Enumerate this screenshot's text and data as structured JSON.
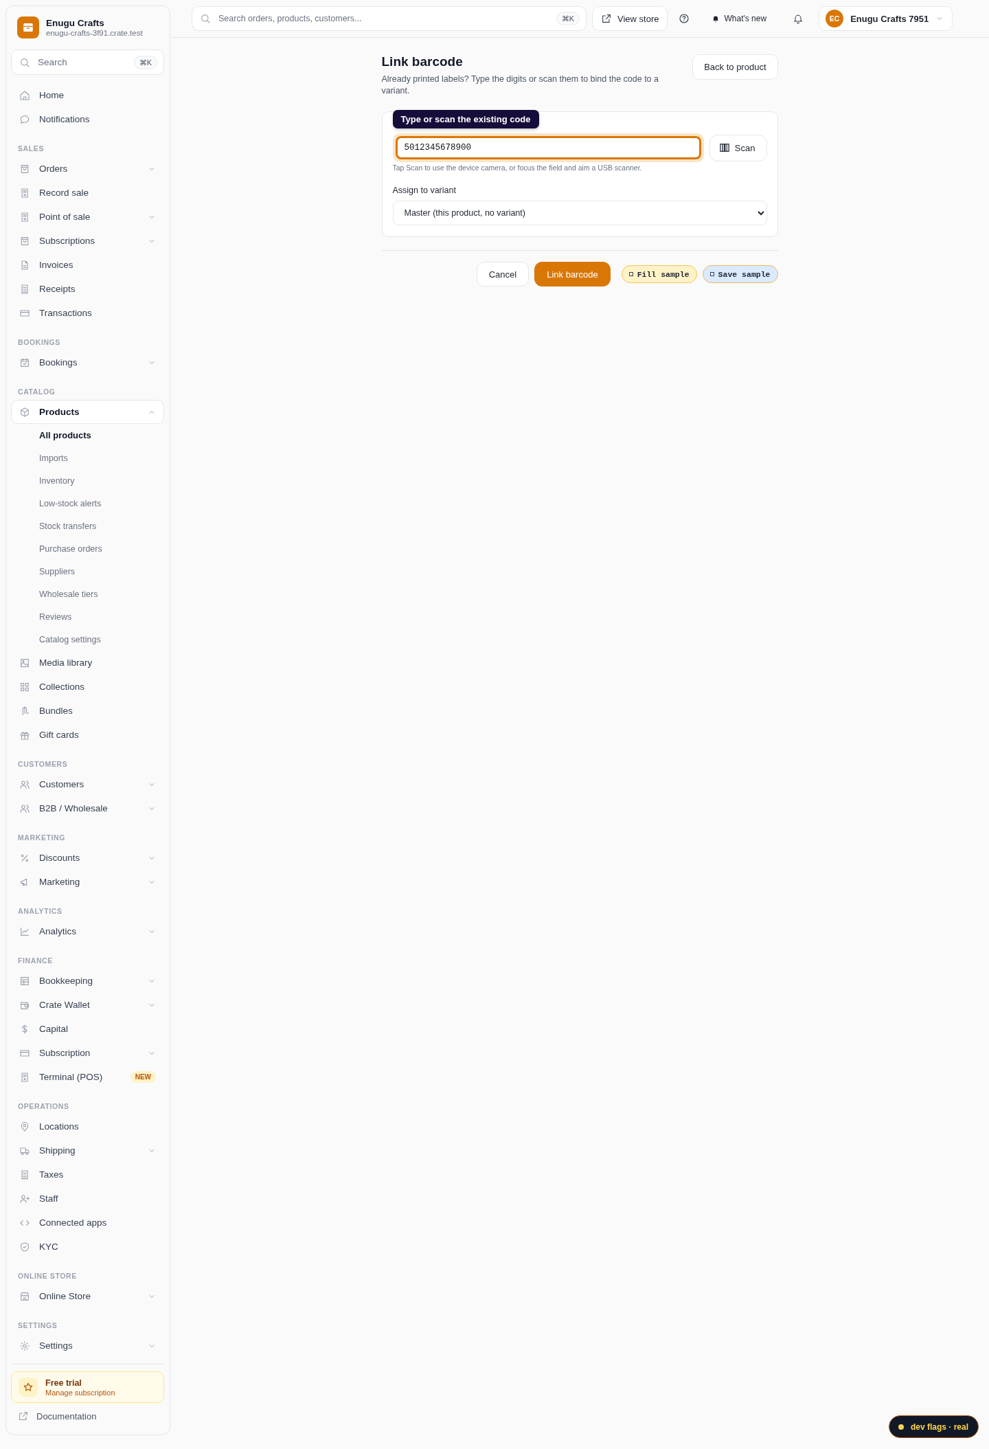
{
  "sidebar": {
    "brand": {
      "name": "Enugu Crafts",
      "domain": "enugu-crafts-3f91.crate.test"
    },
    "search": {
      "placeholder": "Search",
      "shortcut": "⌘K"
    },
    "sections": [
      {
        "items": [
          {
            "label": "Home",
            "kind": "link",
            "selected": false
          },
          {
            "label": "Notifications",
            "kind": "link",
            "selected": false
          }
        ]
      },
      {
        "label": "SALES",
        "items": [
          {
            "label": "Orders",
            "kind": "menu",
            "expanded": false,
            "selected": false
          },
          {
            "label": "Record sale",
            "kind": "link",
            "selected": false
          },
          {
            "label": "Point of sale",
            "kind": "menu",
            "expanded": false,
            "selected": false
          },
          {
            "label": "Subscriptions",
            "kind": "menu",
            "expanded": false,
            "selected": false
          },
          {
            "label": "Invoices",
            "kind": "link",
            "selected": false
          },
          {
            "label": "Receipts",
            "kind": "link",
            "selected": false
          },
          {
            "label": "Transactions",
            "kind": "link",
            "selected": false
          }
        ]
      },
      {
        "label": "BOOKINGS",
        "items": [
          {
            "label": "Bookings",
            "kind": "menu",
            "expanded": false,
            "selected": false
          }
        ]
      },
      {
        "label": "CATALOG",
        "items": [
          {
            "label": "Products",
            "kind": "menu",
            "expanded": true,
            "selected": true,
            "children": [
              {
                "label": "All products",
                "selected": true
              },
              {
                "label": "Imports",
                "selected": false
              },
              {
                "label": "Inventory",
                "selected": false
              },
              {
                "label": "Low-stock alerts",
                "selected": false
              },
              {
                "label": "Stock transfers",
                "selected": false
              },
              {
                "label": "Purchase orders",
                "selected": false
              },
              {
                "label": "Suppliers",
                "selected": false
              },
              {
                "label": "Wholesale tiers",
                "selected": false
              },
              {
                "label": "Reviews",
                "selected": false
              },
              {
                "label": "Catalog settings",
                "selected": false
              }
            ]
          },
          {
            "label": "Media library",
            "kind": "link",
            "selected": false
          },
          {
            "label": "Collections",
            "kind": "link",
            "selected": false
          },
          {
            "label": "Bundles",
            "kind": "link",
            "selected": false
          },
          {
            "label": "Gift cards",
            "kind": "link",
            "selected": false
          }
        ]
      },
      {
        "label": "CUSTOMERS",
        "items": [
          {
            "label": "Customers",
            "kind": "menu",
            "expanded": false,
            "selected": false
          },
          {
            "label": "B2B / Wholesale",
            "kind": "menu",
            "expanded": false,
            "selected": false
          }
        ]
      },
      {
        "label": "MARKETING",
        "items": [
          {
            "label": "Discounts",
            "kind": "menu",
            "expanded": false,
            "selected": false
          },
          {
            "label": "Marketing",
            "kind": "menu",
            "expanded": false,
            "selected": false
          }
        ]
      },
      {
        "label": "ANALYTICS",
        "items": [
          {
            "label": "Analytics",
            "kind": "menu",
            "expanded": false,
            "selected": false
          }
        ]
      },
      {
        "label": "FINANCE",
        "items": [
          {
            "label": "Bookkeeping",
            "kind": "menu",
            "expanded": false,
            "selected": false
          },
          {
            "label": "Crate Wallet",
            "kind": "menu",
            "expanded": false,
            "selected": false
          },
          {
            "label": "Capital",
            "kind": "link",
            "selected": false
          },
          {
            "label": "Subscription",
            "kind": "menu",
            "expanded": false,
            "selected": false
          },
          {
            "label": "Terminal (POS)",
            "kind": "link",
            "selected": false,
            "badge": "NEW"
          }
        ]
      },
      {
        "label": "OPERATIONS",
        "items": [
          {
            "label": "Locations",
            "kind": "link",
            "selected": false
          },
          {
            "label": "Shipping",
            "kind": "menu",
            "expanded": false,
            "selected": false
          },
          {
            "label": "Taxes",
            "kind": "link",
            "selected": false
          },
          {
            "label": "Staff",
            "kind": "link",
            "selected": false
          },
          {
            "label": "Connected apps",
            "kind": "link",
            "selected": false
          },
          {
            "label": "KYC",
            "kind": "link",
            "selected": false
          }
        ]
      },
      {
        "label": "ONLINE STORE",
        "items": [
          {
            "label": "Online Store",
            "kind": "menu",
            "expanded": false,
            "selected": false
          }
        ]
      },
      {
        "label": "SETTINGS",
        "items": [
          {
            "label": "Settings",
            "kind": "menu",
            "expanded": false,
            "selected": false
          }
        ]
      }
    ],
    "trial": {
      "title": "Free trial",
      "subtitle": "Manage subscription"
    },
    "documentation": "Documentation"
  },
  "topbar": {
    "search": {
      "placeholder": "Search orders, products, customers...",
      "shortcut": "⌘K"
    },
    "view_store": "View store",
    "whats_new": "What's new",
    "account": {
      "initials": "EC",
      "name": "Enugu Crafts 7951"
    }
  },
  "page": {
    "title": "Link barcode",
    "subtitle": "Already printed labels? Type the digits or scan them to bind the code to a variant.",
    "back_button": "Back to product",
    "form": {
      "tooltip": "Type or scan the existing code",
      "barcode": {
        "value": "5012345678900",
        "focused": true
      },
      "scan_button": "Scan",
      "hint": "Tap Scan to use the device camera, or focus the field and aim a USB scanner.",
      "variant": {
        "label": "Assign to variant",
        "value": "Master (this product, no variant)"
      }
    },
    "actions": {
      "cancel": "Cancel",
      "submit": "Link barcode"
    },
    "dev_buttons": [
      {
        "label": "Fill sample",
        "kind": "fill"
      },
      {
        "label": "Save sample",
        "kind": "save"
      }
    ]
  },
  "dev_flags": {
    "label": "dev flags · real"
  }
}
